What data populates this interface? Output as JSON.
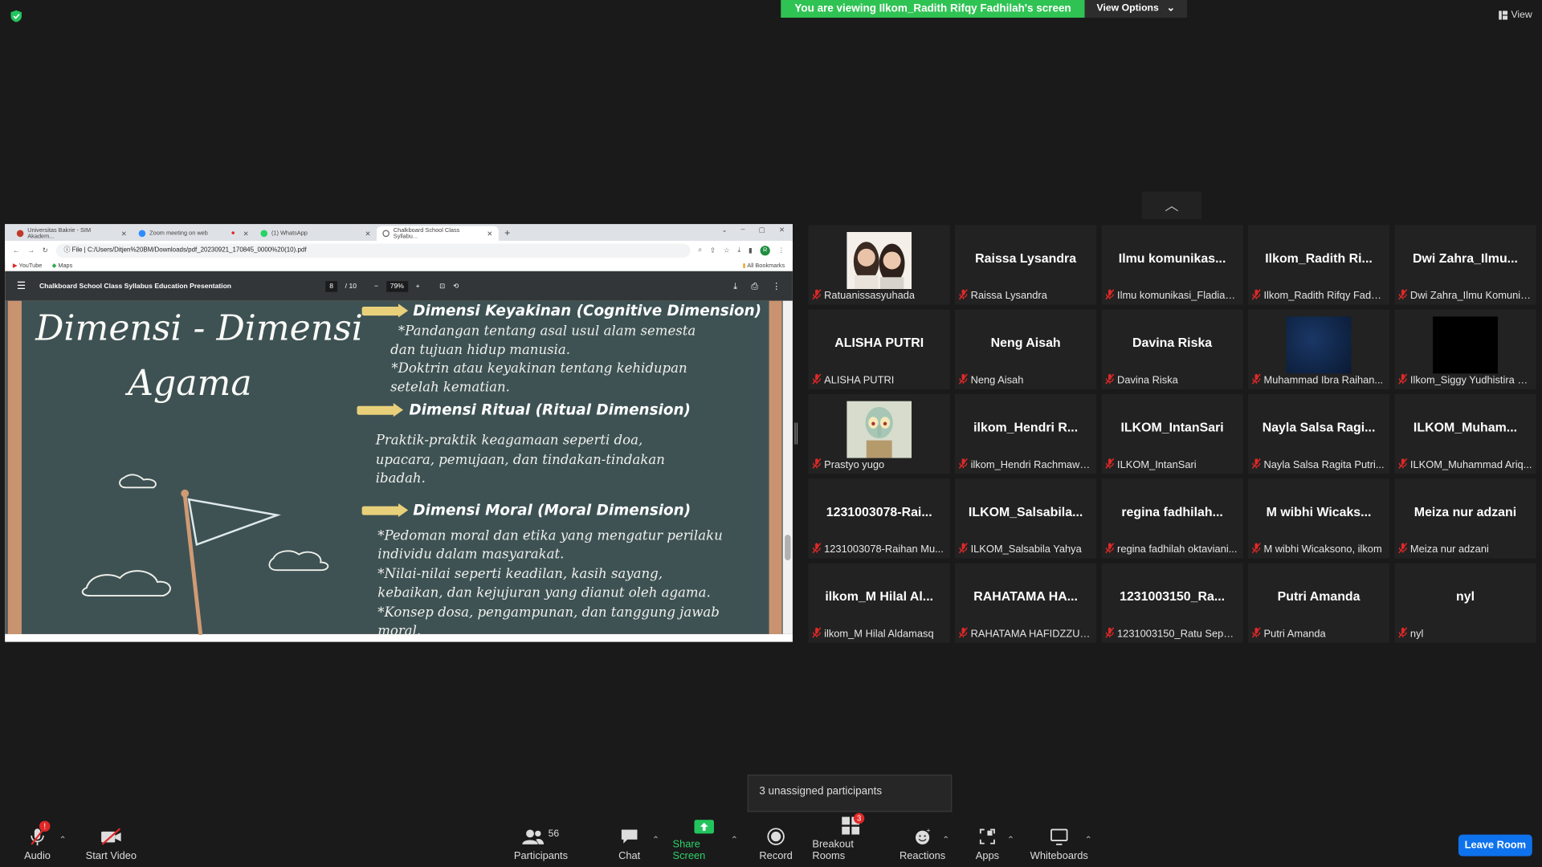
{
  "banner": {
    "viewing_text": "You are viewing Ilkom_Radith Rifqy Fadhilah's screen",
    "view_options": "View Options"
  },
  "top_right": {
    "view_label": "View"
  },
  "browser": {
    "tabs": [
      {
        "title": "Universitas Bakrie - SIM Akadem...",
        "fav_color": "#c0392b"
      },
      {
        "title": "Zoom meeting on web",
        "fav_color": "#2d8cff"
      },
      {
        "title": "(1) WhatsApp",
        "fav_color": "#25d366"
      },
      {
        "title": "Chalkboard School Class Syllabu...",
        "fav_color": "#666666"
      }
    ],
    "url_prefix": "File",
    "url": "C:/Users/Ditjen%20BM/Downloads/pdf_20230921_170845_0000%20(10).pdf",
    "avatar_letter": "R",
    "bookmarks": [
      "YouTube",
      "Maps"
    ],
    "all_bookmarks": "All Bookmarks",
    "pdf_title": "Chalkboard School Class Syllabus Education Presentation",
    "page_current": "8",
    "page_total": "/ 10",
    "zoom": "79%"
  },
  "slide": {
    "title_line1": "Dimensi - Dimensi",
    "title_line2": "Agama",
    "h1": "Dimensi Keyakinan (Cognitive Dimension)",
    "p1a": "*Pandangan tentang asal usul alam semesta",
    "p1b": "dan tujuan hidup manusia.",
    "p1c": "*Doktrin atau keyakinan tentang kehidupan",
    "p1d": "setelah kematian.",
    "h2": "Dimensi Ritual (Ritual Dimension)",
    "p2a": "Praktik-praktik keagamaan seperti doa,",
    "p2b": "upacara, pemujaan, dan tindakan-tindakan",
    "p2c": "ibadah.",
    "h3": "Dimensi Moral (Moral Dimension)",
    "p3a": "*Pedoman moral dan etika yang mengatur perilaku",
    "p3b": "individu dalam masyarakat.",
    "p3c": "*Nilai-nilai seperti keadilan, kasih sayang,",
    "p3d": "kebaikan, dan kejujuran yang dianut oleh agama.",
    "p3e": "*Konsep dosa, pengampunan, dan tanggung jawab",
    "p3f": "moral."
  },
  "participants": [
    {
      "display": "",
      "label": "Ratuanissasyuhada",
      "pic": "photo"
    },
    {
      "display": "Raissa Lysandra",
      "label": "Raissa Lysandra"
    },
    {
      "display": "Ilmu  komunikas...",
      "label": "Ilmu komunikasi_Fladian ..."
    },
    {
      "display": "Ilkom_Radith  Ri...",
      "label": "Ilkom_Radith Rifqy Fadhi..."
    },
    {
      "display": "Dwi  Zahra_Ilmu...",
      "label": "Dwi Zahra_Ilmu Komunik..."
    },
    {
      "display": "ALISHA PUTRI",
      "label": "ALISHA PUTRI"
    },
    {
      "display": "Neng Aisah",
      "label": "Neng Aisah"
    },
    {
      "display": "Davina Riska",
      "label": "Davina Riska"
    },
    {
      "display": "",
      "label": "Muhammad Ibra Raihan...",
      "pic": "blue"
    },
    {
      "display": "",
      "label": "Ilkom_Siggy Yudhistira D...",
      "pic": "black"
    },
    {
      "display": "",
      "label": "Prastyo yugo",
      "pic": "cartoon"
    },
    {
      "display": "ilkom_Hendri  R...",
      "label": "ilkom_Hendri Rachmawa..."
    },
    {
      "display": "ILKOM_IntanSari",
      "label": "ILKOM_IntanSari"
    },
    {
      "display": "Nayla  Salsa  Ragi...",
      "label": "Nayla Salsa Ragita Putri..."
    },
    {
      "display": "ILKOM_Muham...",
      "label": "ILKOM_Muhammad Ariq..."
    },
    {
      "display": "1231003078-Rai...",
      "label": "1231003078-Raihan Mu..."
    },
    {
      "display": "ILKOM_Salsabila...",
      "label": "ILKOM_Salsabila Yahya"
    },
    {
      "display": "regina  fadhilah...",
      "label": "regina fadhilah oktaviani..."
    },
    {
      "display": "M  wibhi  Wicaks...",
      "label": "M wibhi Wicaksono, ilkom"
    },
    {
      "display": "Meiza nur adzani",
      "label": "Meiza nur adzani"
    },
    {
      "display": "ilkom_M  Hilal  Al...",
      "label": "ilkom_M Hilal Aldamasq"
    },
    {
      "display": "RAHATAMA  HA...",
      "label": "RAHATAMA HAFIDZZUD..."
    },
    {
      "display": "1231003150_Ra...",
      "label": "1231003150_Ratu Sephi..."
    },
    {
      "display": "Putri Amanda",
      "label": "Putri Amanda"
    },
    {
      "display": "nyl",
      "label": "nyl"
    }
  ],
  "tooltip": "3 unassigned participants",
  "toolbar": {
    "audio": "Audio",
    "audio_badge": "!",
    "video": "Start Video",
    "participants": "Participants",
    "participants_count": "56",
    "chat": "Chat",
    "share": "Share Screen",
    "record": "Record",
    "breakout": "Breakout Rooms",
    "breakout_badge": "3",
    "reactions": "Reactions",
    "apps": "Apps",
    "whiteboards": "Whiteboards",
    "leave": "Leave Room"
  },
  "colors": {
    "share_green": "#2fc353",
    "leave_blue": "#0e72ed",
    "chalkboard": "#3e5254",
    "mute_red": "#e02828"
  }
}
